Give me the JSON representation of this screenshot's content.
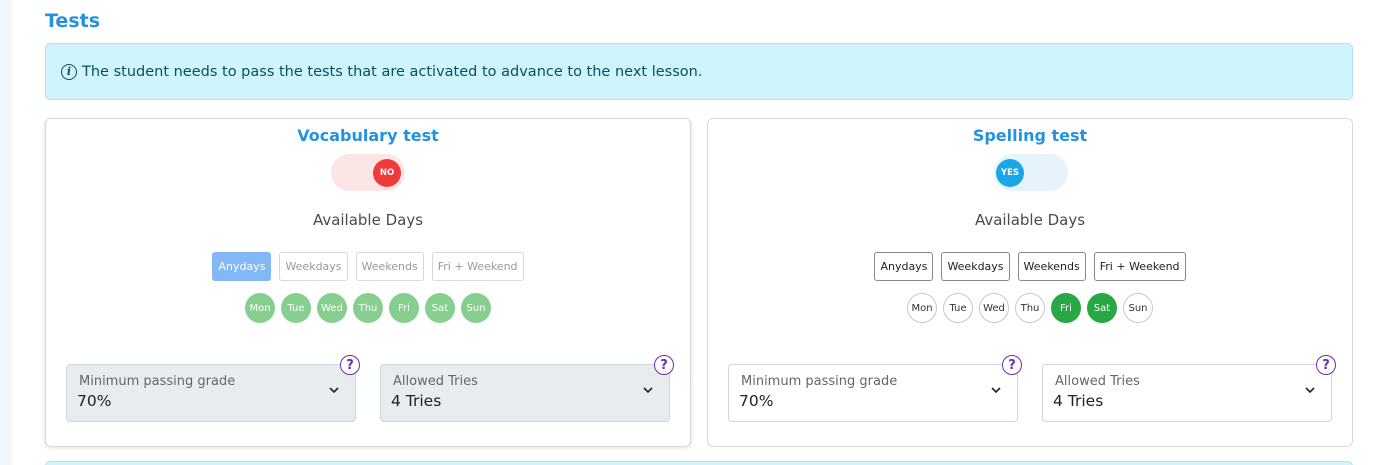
{
  "page": {
    "title": "Tests",
    "info_message": "The student needs to pass the tests that are activated to advance to the next lesson.",
    "info_icon": "info-circle-icon"
  },
  "tests": [
    {
      "title": "Vocabulary test",
      "toggle": {
        "state": "off",
        "label": "NO"
      },
      "available_days_label": "Available Days",
      "presets": [
        "Anydays",
        "Weekdays",
        "Weekends",
        "Fri + Weekend"
      ],
      "active_preset": "Anydays",
      "days": [
        "Mon",
        "Tue",
        "Wed",
        "Thu",
        "Fri",
        "Sat",
        "Sun"
      ],
      "active_days": [
        "Mon",
        "Tue",
        "Wed",
        "Thu",
        "Fri",
        "Sat",
        "Sun"
      ],
      "disabled": true,
      "min_grade": {
        "label": "Minimum passing grade",
        "value": "70%"
      },
      "allowed_tries": {
        "label": "Allowed Tries",
        "value": "4 Tries"
      },
      "help_symbol": "?"
    },
    {
      "title": "Spelling test",
      "toggle": {
        "state": "on",
        "label": "YES"
      },
      "available_days_label": "Available Days",
      "presets": [
        "Anydays",
        "Weekdays",
        "Weekends",
        "Fri + Weekend"
      ],
      "active_preset": "",
      "days": [
        "Mon",
        "Tue",
        "Wed",
        "Thu",
        "Fri",
        "Sat",
        "Sun"
      ],
      "active_days": [
        "Fri",
        "Sat"
      ],
      "disabled": false,
      "min_grade": {
        "label": "Minimum passing grade",
        "value": "70%"
      },
      "allowed_tries": {
        "label": "Allowed Tries",
        "value": "4 Tries"
      },
      "help_symbol": "?"
    }
  ],
  "colors": {
    "title_blue": "#2592e0",
    "info_bg": "#cff4fc",
    "toggle_off": "#ef3b3b",
    "toggle_on": "#1ca6ea",
    "day_active": "#28a745",
    "help_purple": "#6f2dab"
  }
}
